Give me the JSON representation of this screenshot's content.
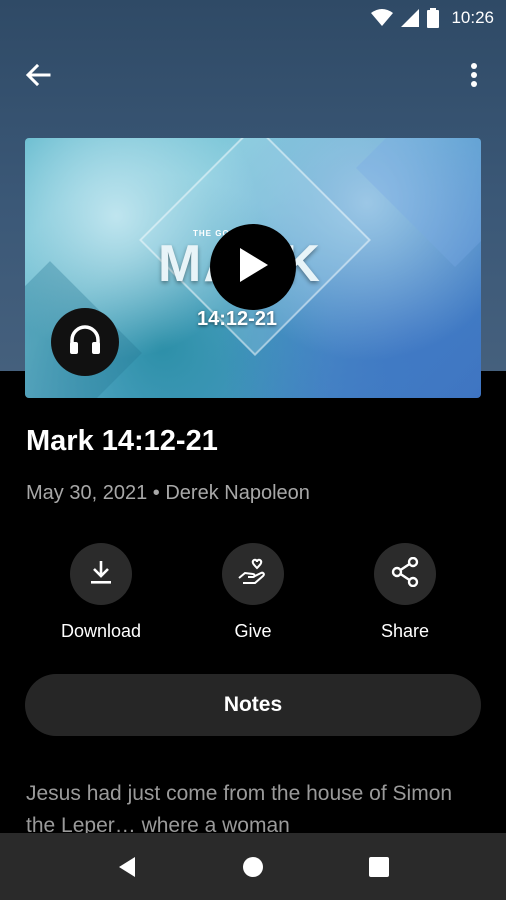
{
  "status_bar": {
    "time": "10:26"
  },
  "app_bar": {
    "back_icon": "arrow-back-icon",
    "menu_icon": "more-vert-icon"
  },
  "artwork": {
    "pre_title": "THE GOSPEL OF",
    "series_title": "MARK",
    "reference": "14:12-21"
  },
  "sermon": {
    "title": "Mark 14:12-21",
    "date": "May 30, 2021",
    "separator": "•",
    "speaker": "Derek Napoleon"
  },
  "actions": [
    {
      "label": "Download",
      "icon": "download-icon"
    },
    {
      "label": "Give",
      "icon": "give-heart-hand-icon"
    },
    {
      "label": "Share",
      "icon": "share-icon"
    }
  ],
  "notes_button": {
    "label": "Notes"
  },
  "description": "Jesus had just come from the house of Simon the Leper… where a woman",
  "nav_bar": {
    "back": "nav-back-icon",
    "home": "nav-home-icon",
    "recents": "nav-recents-icon"
  }
}
